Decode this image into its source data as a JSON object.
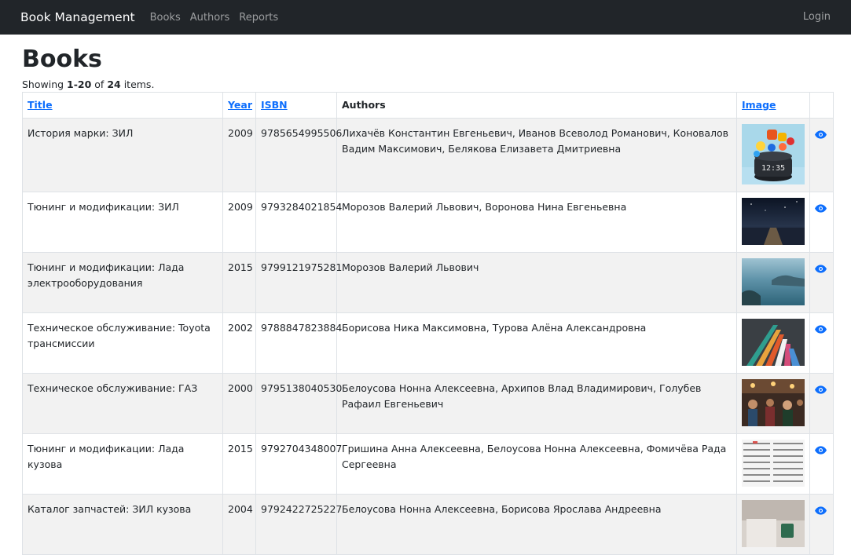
{
  "navbar": {
    "brand": "Book Management",
    "links": [
      "Books",
      "Authors",
      "Reports"
    ],
    "login": "Login"
  },
  "page": {
    "title": "Books",
    "summary_prefix": "Showing ",
    "summary_range": "1-20",
    "summary_of": " of ",
    "summary_total": "24",
    "summary_suffix": " items."
  },
  "table": {
    "headers": {
      "title": "Title",
      "year": "Year",
      "isbn": "ISBN",
      "authors": "Authors",
      "image": "Image"
    },
    "rows": [
      {
        "title": "История марки: ЗИЛ",
        "year": "2009",
        "isbn": "9785654995506",
        "authors": "Лихачёв Константин Евгеньевич, Иванов Всеволод Романович, Коновалов Вадим Максимович, Белякова Елизавета Дмитриевна",
        "image": "speaker-with-app-icons"
      },
      {
        "title": "Тюнинг и модификации: ЗИЛ",
        "year": "2009",
        "isbn": "9793284021854",
        "authors": "Морозов Валерий Львович, Воронова Нина Евгеньевна",
        "image": "night-pier"
      },
      {
        "title": "Тюнинг и модификации: Лада электрооборудования",
        "year": "2015",
        "isbn": "9799121975281",
        "authors": "Морозов Валерий Львович",
        "image": "lake-mountains"
      },
      {
        "title": "Техническое обслуживание: Toyota трансмиссии",
        "year": "2002",
        "isbn": "9788847823884",
        "authors": "Борисова Ника Максимовна, Турова Алёна Александровна",
        "image": "colorful-hangers"
      },
      {
        "title": "Техническое обслуживание: ГАЗ",
        "year": "2000",
        "isbn": "9795138040530",
        "authors": "Белоусова Нонна Алексеевна, Архипов Влад Владимирович, Голубев Рафаил Евгеньевич",
        "image": "crowded-cafe"
      },
      {
        "title": "Тюнинг и модификации: Лада кузова",
        "year": "2015",
        "isbn": "9792704348007",
        "authors": "Гришина Анна Алексеевна, Белоусова Нонна Алексеевна, Фомичёва Рада Сергеевна",
        "image": "spreadsheet-grid"
      },
      {
        "title": "Каталог запчастей: ЗИЛ кузова",
        "year": "2004",
        "isbn": "9792422725227",
        "authors": "Белоусова Нонна Алексеевна, Борисова Ярослава Андреевна",
        "image": "cozy-mug"
      }
    ]
  }
}
